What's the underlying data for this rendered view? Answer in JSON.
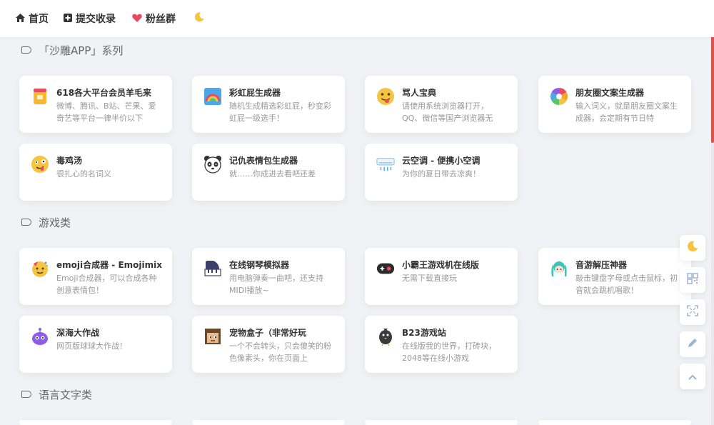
{
  "nav": {
    "home": "首页",
    "submit": "提交收录",
    "fans": "粉丝群"
  },
  "sections": {
    "shadiao": "「沙雕APP」系列",
    "games": "游戏类",
    "language": "语言文字类"
  },
  "cards": {
    "c1": {
      "title": "618各大平台会员羊毛来",
      "desc": "微博、腾讯、B站、芒果、爱奇艺等平台一律半价以下",
      "icon": "coin-cup-icon"
    },
    "c2": {
      "title": "彩虹屁生成器",
      "desc": "随机生成精选彩虹屁，秒变彩虹屁一级选手！",
      "icon": "rainbow-icon"
    },
    "c3": {
      "title": "骂人宝典",
      "desc": "请使用系统浏览器打开，QQ、微信等国产浏览器无",
      "icon": "tongue-emoji-icon"
    },
    "c4": {
      "title": "朋友圈文案生成器",
      "desc": "输入词义，就是朋友圈文案生成器，会定期有节日特",
      "icon": "aperture-icon"
    },
    "c5": {
      "title": "毒鸡汤",
      "desc": "很扎心的名词义",
      "icon": "crazy-face-icon"
    },
    "c6": {
      "title": "记仇表情包生成器",
      "desc": "就……你成进去看吧还差",
      "icon": "panda-icon"
    },
    "c7": {
      "title": "云空调 - 便携小空调",
      "desc": "为你的夏日带去凉爽！",
      "icon": "air-conditioner-icon"
    },
    "g1": {
      "title": "emoji合成器 - Emojimix",
      "desc": "Emoji合成器，可以合成各种创意表情包！",
      "icon": "party-emoji-icon"
    },
    "g2": {
      "title": "在线钢琴模拟器",
      "desc": "用电脑弹奏一曲吧，还支持MIDI播放~",
      "icon": "piano-icon"
    },
    "g3": {
      "title": "小霸王游戏机在线版",
      "desc": "无需下载直接玩",
      "icon": "gamepad-icon"
    },
    "g4": {
      "title": "音游解压神器",
      "desc": "敲击键盘字母或点击鼠标，初音就会跳机唱歌！",
      "icon": "miku-icon"
    },
    "g5": {
      "title": "深海大作战",
      "desc": "网页版球球大作战！",
      "icon": "blob-monster-icon"
    },
    "g6": {
      "title": "宠物盒子（非常好玩",
      "desc": "一个不会转头，只会傻笑的粉色像素头，你在页面上",
      "icon": "pixel-pet-icon"
    },
    "g7": {
      "title": "B23游戏站",
      "desc": "在线版我的世界，打砖块，2048等在线小游戏",
      "icon": "bird-icon"
    }
  },
  "colors": {
    "background": "#f1f2f5",
    "card": "#ffffff",
    "heart": "#e84a5f",
    "moon": "#f5c542",
    "scroll_accent": "#d9534f"
  }
}
